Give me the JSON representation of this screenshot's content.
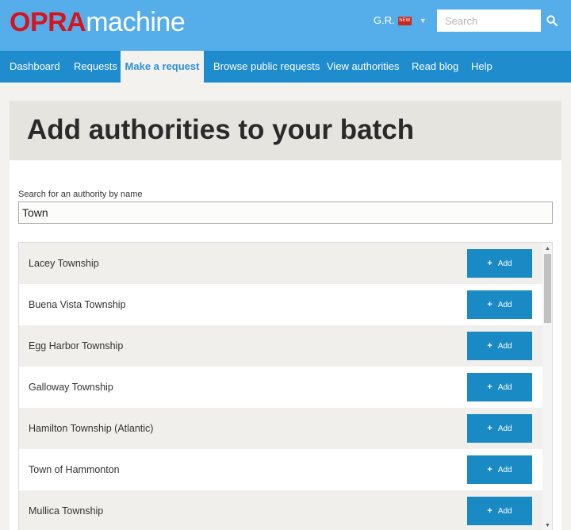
{
  "header": {
    "logo_opra": "OPRA",
    "logo_machine": "machine",
    "user_initials": "G.R.",
    "user_badge": "NEW",
    "search_placeholder": "Search"
  },
  "nav": {
    "items": [
      {
        "label": "Dashboard",
        "active": false
      },
      {
        "label": "Requests",
        "active": false
      },
      {
        "label": "Make a request",
        "active": true
      },
      {
        "label": "Browse public requests",
        "active": false
      },
      {
        "label": "View authorities",
        "active": false
      },
      {
        "label": "Read blog",
        "active": false
      },
      {
        "label": "Help",
        "active": false
      }
    ]
  },
  "page": {
    "title": "Add authorities to your batch",
    "search_label": "Search for an authority by name",
    "search_value": "Town"
  },
  "results": {
    "add_label": "Add",
    "items": [
      "Lacey Township",
      "Buena Vista Township",
      "Egg Harbor Township",
      "Galloway Township",
      "Hamilton Township (Atlantic)",
      "Town of Hammonton",
      "Mullica Township"
    ]
  },
  "colors": {
    "header_bg": "#55aeea",
    "nav_bg": "#1e8ccd",
    "logo_red": "#d6141e",
    "button_blue": "#1a8ac4"
  },
  "icons": {
    "search": "magnifier",
    "caret": "chevron-down",
    "add": "plus",
    "scroll_up": "triangle-up",
    "scroll_down": "triangle-down"
  }
}
